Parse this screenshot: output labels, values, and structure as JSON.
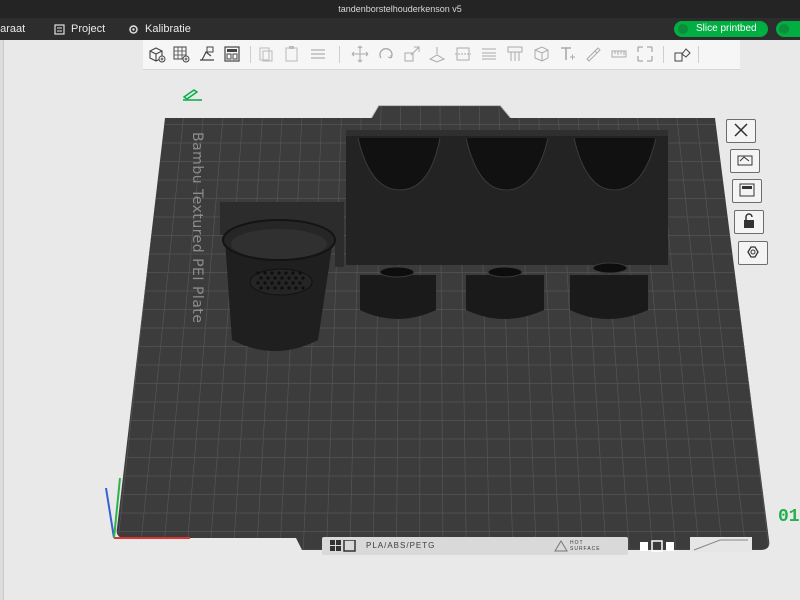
{
  "window": {
    "title": "tandenborstelhouderkenson v5"
  },
  "menu": {
    "items": [
      {
        "label": "paraat",
        "icon": "printer-icon"
      },
      {
        "label": "Project",
        "icon": "project-icon"
      },
      {
        "label": "Kalibratie",
        "icon": "calibration-icon"
      }
    ]
  },
  "slice_button": {
    "label": "Slice printbed"
  },
  "plate": {
    "name": "Bambu Textured PEI Plate",
    "filament_label": "PLA/ABS/PETG",
    "hot_surface_label": "HOT SURFACE"
  },
  "coordinate_readout": "01",
  "colors": {
    "accent": "#00ae42",
    "bed": "#3c3c3c",
    "grid": "#5a5a5a",
    "model": "#1e1e1e"
  }
}
